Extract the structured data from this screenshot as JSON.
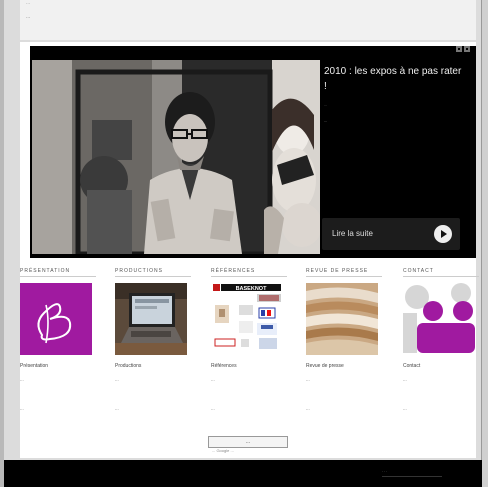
{
  "top": {
    "line1": "...",
    "line2": "..."
  },
  "hero": {
    "title": "2010 : les expos à ne pas rater !",
    "meta": "...",
    "paragraph": "...",
    "read_more": "Lire la suite"
  },
  "sections": [
    {
      "heading": "PRÉSENTATION",
      "caption": "Présentation",
      "sub": "",
      "desc": "...",
      "link": "..."
    },
    {
      "heading": "PRODUCTIONS",
      "caption": "Productions",
      "sub": "",
      "desc": "...",
      "link": "..."
    },
    {
      "heading": "RÉFÉRENCES",
      "caption": "Références",
      "sub": "",
      "desc": "...",
      "link": "..."
    },
    {
      "heading": "REVUE DE PRESSE",
      "caption": "Revue de presse",
      "sub": "",
      "desc": "...",
      "link": "..."
    },
    {
      "heading": "CONTACT",
      "caption": "Contact",
      "sub": "",
      "desc": "...",
      "link": "..."
    }
  ],
  "bottom": {
    "button": "...",
    "note": "... Google ..."
  },
  "footer": {
    "label": "..."
  },
  "logos": {
    "baseknot": "BASEKNOT"
  },
  "colors": {
    "accent": "#a01aa0",
    "hero_bg": "#000000",
    "page_bg": "#ffffff"
  }
}
